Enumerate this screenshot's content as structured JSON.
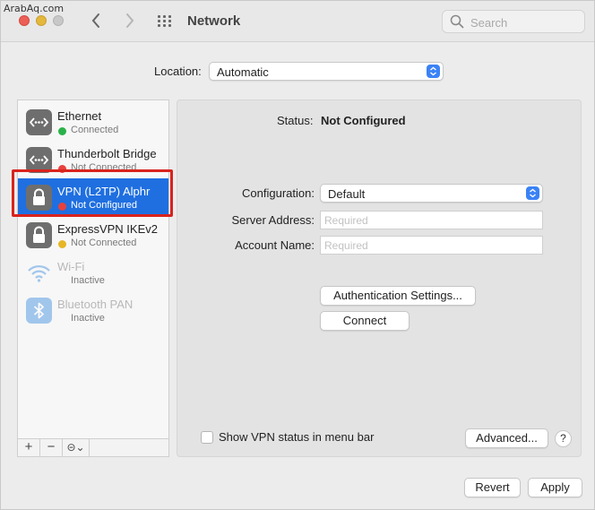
{
  "watermark": "ArabAq.com",
  "window": {
    "title": "Network"
  },
  "toolbar": {
    "back_icon": "chevron-left-icon",
    "forward_icon": "chevron-right-icon",
    "grid_icon": "grid-icon",
    "search_placeholder": "Search"
  },
  "location": {
    "label": "Location:",
    "value": "Automatic"
  },
  "services": [
    {
      "name": "Ethernet",
      "status": "Connected",
      "status_color": "#2ab24a",
      "icon": "ethernet-icon"
    },
    {
      "name": "Thunderbolt Bridge",
      "status": "Not Connected",
      "status_color": "#e8413c",
      "icon": "thunderbolt-bridge-icon"
    },
    {
      "name": "VPN (L2TP) Alphr",
      "status": "Not Configured",
      "status_color": "#e8413c",
      "icon": "lock-icon",
      "selected": true
    },
    {
      "name": "ExpressVPN IKEv2",
      "status": "Not Connected",
      "status_color": "#e6b624",
      "icon": "lock-icon"
    },
    {
      "name": "Wi-Fi",
      "status": "Inactive",
      "status_color": "",
      "icon": "wifi-icon"
    },
    {
      "name": "Bluetooth PAN",
      "status": "Inactive",
      "status_color": "",
      "icon": "bluetooth-icon"
    }
  ],
  "sidebar_toolbar": {
    "add": "+",
    "remove": "−",
    "more": "⊝⌄"
  },
  "detail": {
    "status_label": "Status:",
    "status_value": "Not Configured",
    "configuration_label": "Configuration:",
    "configuration_value": "Default",
    "server_label": "Server Address:",
    "server_placeholder": "Required",
    "account_label": "Account Name:",
    "account_placeholder": "Required",
    "auth_button": "Authentication Settings...",
    "connect_button": "Connect",
    "show_vpn_label": "Show VPN status in menu bar",
    "show_vpn_checked": false,
    "advanced_button": "Advanced...",
    "help_button": "?"
  },
  "footer": {
    "revert": "Revert",
    "apply": "Apply"
  },
  "colors": {
    "accent": "#1f6fe0",
    "highlight": "#d9231d"
  }
}
